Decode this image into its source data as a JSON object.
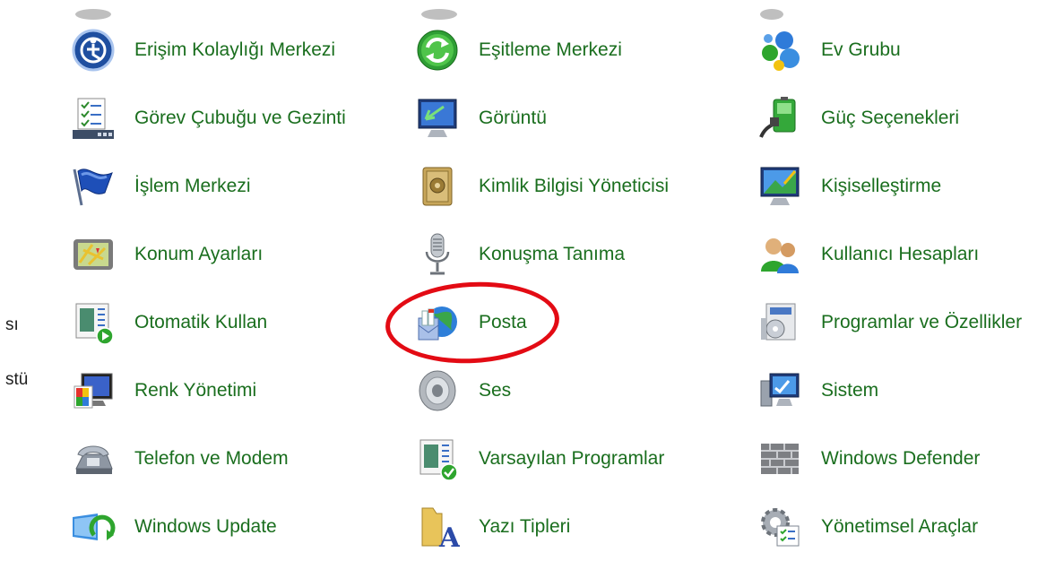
{
  "edge_fragments": [
    "sı",
    "stü"
  ],
  "columns": [
    [
      {
        "label": "Erişim Kolaylığı Merkezi",
        "icon": "accessibility-icon"
      },
      {
        "label": "Görev Çubuğu ve Gezinti",
        "icon": "taskbar-icon"
      },
      {
        "label": "İşlem Merkezi",
        "icon": "flag-icon"
      },
      {
        "label": "Konum Ayarları",
        "icon": "location-map-icon"
      },
      {
        "label": "Otomatik Kullan",
        "icon": "autoplay-icon"
      },
      {
        "label": "Renk Yönetimi",
        "icon": "color-management-icon"
      },
      {
        "label": "Telefon ve Modem",
        "icon": "telephone-icon"
      },
      {
        "label": "Windows Update",
        "icon": "windows-update-icon"
      }
    ],
    [
      {
        "label": "Eşitleme Merkezi",
        "icon": "sync-icon"
      },
      {
        "label": "Görüntü",
        "icon": "display-icon"
      },
      {
        "label": "Kimlik Bilgisi Yöneticisi",
        "icon": "vault-icon"
      },
      {
        "label": "Konuşma Tanıma",
        "icon": "microphone-icon"
      },
      {
        "label": "Posta",
        "icon": "mail-icon"
      },
      {
        "label": "Ses",
        "icon": "speaker-icon"
      },
      {
        "label": "Varsayılan Programlar",
        "icon": "default-programs-icon"
      },
      {
        "label": "Yazı Tipleri",
        "icon": "fonts-folder-icon"
      }
    ],
    [
      {
        "label": "Ev Grubu",
        "icon": "homegroup-icon"
      },
      {
        "label": "Güç Seçenekleri",
        "icon": "power-battery-icon"
      },
      {
        "label": "Kişiselleştirme",
        "icon": "personalization-icon"
      },
      {
        "label": "Kullanıcı Hesapları",
        "icon": "user-accounts-icon"
      },
      {
        "label": "Programlar ve Özellikler",
        "icon": "programs-features-icon"
      },
      {
        "label": "Sistem",
        "icon": "system-computer-icon"
      },
      {
        "label": "Windows Defender",
        "icon": "firewall-wall-icon"
      },
      {
        "label": "Yönetimsel Araçlar",
        "icon": "admin-tools-gear-icon"
      }
    ]
  ],
  "colors": {
    "link": "#1a6e1e",
    "highlight_circle": "#e30b14"
  }
}
